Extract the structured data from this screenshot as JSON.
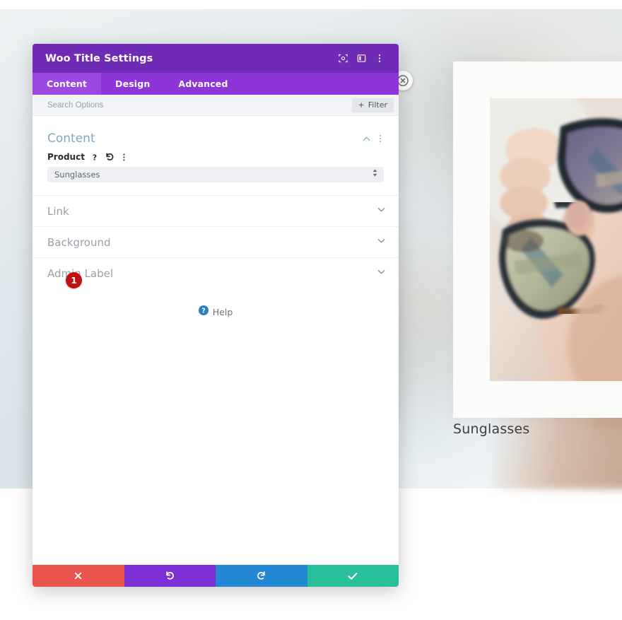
{
  "modal": {
    "title": "Woo Title Settings",
    "header_icons": [
      {
        "name": "focus-target-icon",
        "label": "Focus"
      },
      {
        "name": "layout-columns-icon",
        "label": "Layout"
      },
      {
        "name": "vertical-dots-icon",
        "label": "More Options"
      }
    ],
    "tabs": [
      {
        "label": "Content",
        "active": true
      },
      {
        "label": "Design",
        "active": false
      },
      {
        "label": "Advanced",
        "active": false
      }
    ],
    "search": {
      "placeholder": "Search Options",
      "value": "",
      "filter_label": "Filter",
      "filter_plus": "+"
    },
    "sections": {
      "content": {
        "title": "Content",
        "collapse_state": "expanded",
        "field": {
          "label": "Product",
          "value": "Sunglasses",
          "options": [
            "Sunglasses"
          ],
          "icons": [
            "help-question-icon",
            "reset-undo-icon",
            "vertical-dots-icon"
          ]
        }
      },
      "collapsed": [
        {
          "label": "Link"
        },
        {
          "label": "Background"
        },
        {
          "label": "Admin Label"
        }
      ]
    },
    "help": {
      "label": "Help",
      "icon": "help-circle-icon"
    },
    "footer_actions": [
      {
        "name": "cancel-button",
        "icon": "close-x-icon",
        "color": "#e9554d"
      },
      {
        "name": "undo-button",
        "icon": "undo-arrow-icon",
        "color": "#7b2fd4"
      },
      {
        "name": "redo-button",
        "icon": "redo-arrow-icon",
        "color": "#2487d4"
      },
      {
        "name": "save-button",
        "icon": "checkmark-icon",
        "color": "#27c09a"
      }
    ]
  },
  "canvas": {
    "close_button_icon": "close-circle-icon",
    "product": {
      "caption": "Sunglasses",
      "image_alt": "hand-holding-sunglasses"
    }
  },
  "annotations": {
    "step_badges": [
      {
        "number": "1",
        "target": "product-select"
      }
    ]
  },
  "colors": {
    "header_purple": "#6f2bb5",
    "tabs_purple": "#8d35d9",
    "tab_active_purple": "#9b48e3",
    "section_title_blue": "#7fa8bd",
    "badge_red": "#c20f0f",
    "cancel_red": "#e9554d",
    "undo_purple": "#7b2fd4",
    "redo_blue": "#2487d4",
    "save_teal": "#27c09a"
  }
}
